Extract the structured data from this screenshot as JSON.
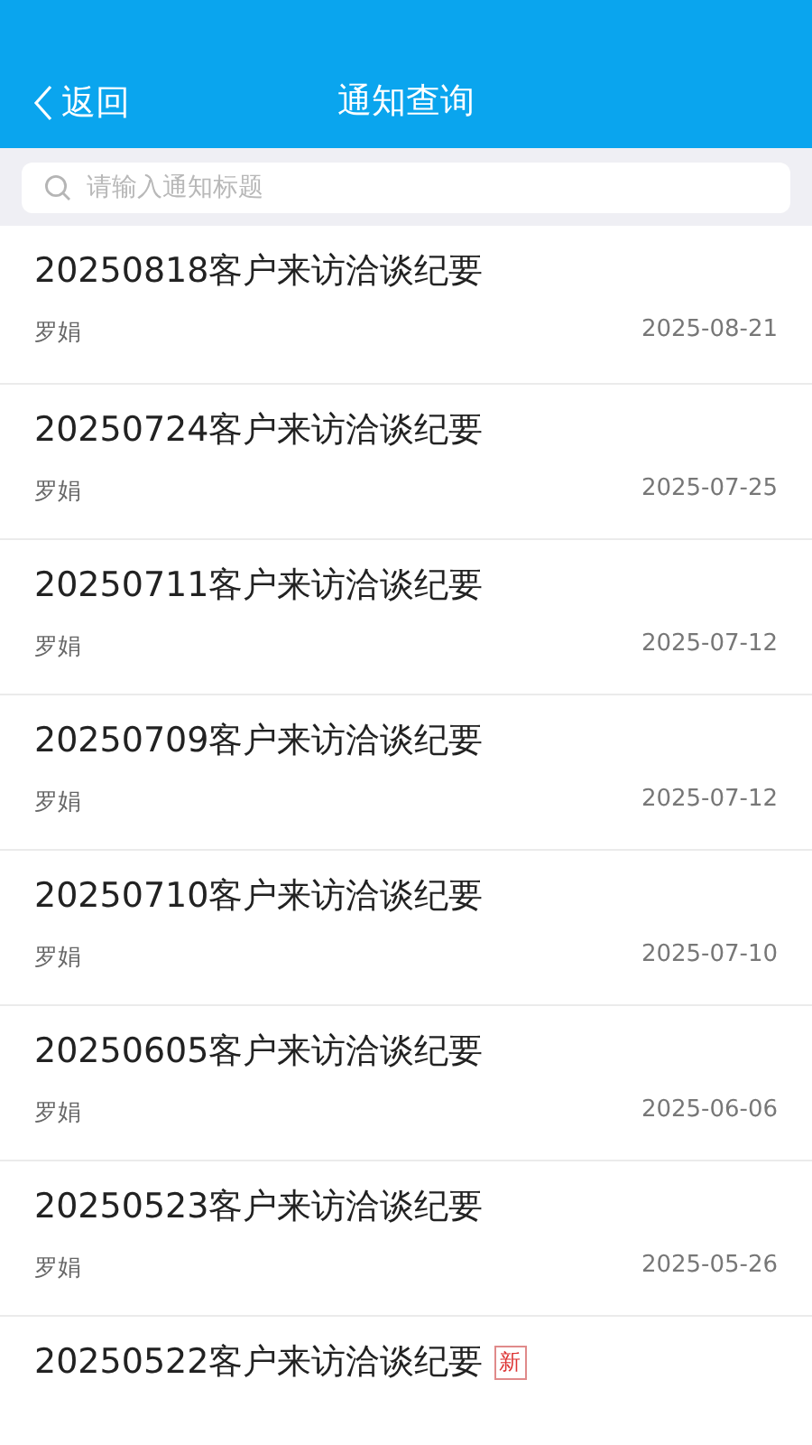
{
  "header": {
    "back_label": "返回",
    "title": "通知查询"
  },
  "search": {
    "placeholder": "请输入通知标题"
  },
  "notices": [
    {
      "title": "20250818客户来访洽谈纪要",
      "author": "罗娟",
      "date": "2025-08-21",
      "new": false
    },
    {
      "title": "20250724客户来访洽谈纪要",
      "author": "罗娟",
      "date": "2025-07-25",
      "new": false
    },
    {
      "title": "20250711客户来访洽谈纪要",
      "author": "罗娟",
      "date": "2025-07-12",
      "new": false
    },
    {
      "title": "20250709客户来访洽谈纪要",
      "author": "罗娟",
      "date": "2025-07-12",
      "new": false
    },
    {
      "title": "20250710客户来访洽谈纪要",
      "author": "罗娟",
      "date": "2025-07-10",
      "new": false
    },
    {
      "title": "20250605客户来访洽谈纪要",
      "author": "罗娟",
      "date": "2025-06-06",
      "new": false
    },
    {
      "title": "20250523客户来访洽谈纪要",
      "author": "罗娟",
      "date": "2025-05-26",
      "new": false
    },
    {
      "title": "20250522客户来访洽谈纪要",
      "new": true,
      "badge": "新"
    }
  ]
}
